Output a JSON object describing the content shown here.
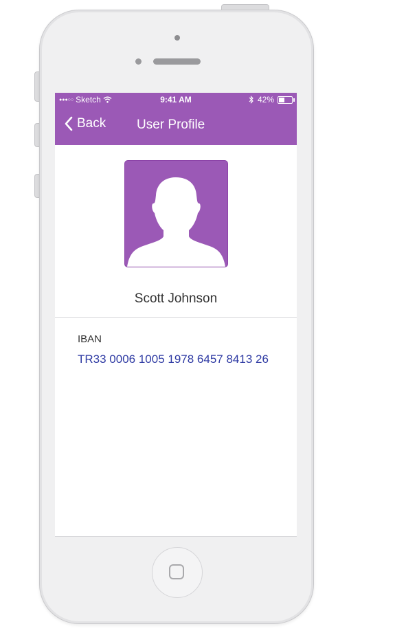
{
  "status_bar": {
    "signal": "●●●○○",
    "carrier": "Sketch",
    "time": "9:41 AM",
    "battery_text": "42%",
    "battery_level": 0.42,
    "icons": [
      "wifi-icon",
      "bluetooth-icon",
      "battery-icon"
    ]
  },
  "nav": {
    "back_label": "Back",
    "title": "User Profile",
    "back_icon": "chevron-left-icon"
  },
  "profile": {
    "avatar_icon": "user-silhouette-icon",
    "name": "Scott Johnson"
  },
  "details": {
    "iban_label": "IBAN",
    "iban_value": "TR33 0006 1005 1978 6457 8413 26"
  },
  "colors": {
    "accent": "#9b59b6",
    "iban_text": "#2e3aa3",
    "text": "#333333"
  }
}
